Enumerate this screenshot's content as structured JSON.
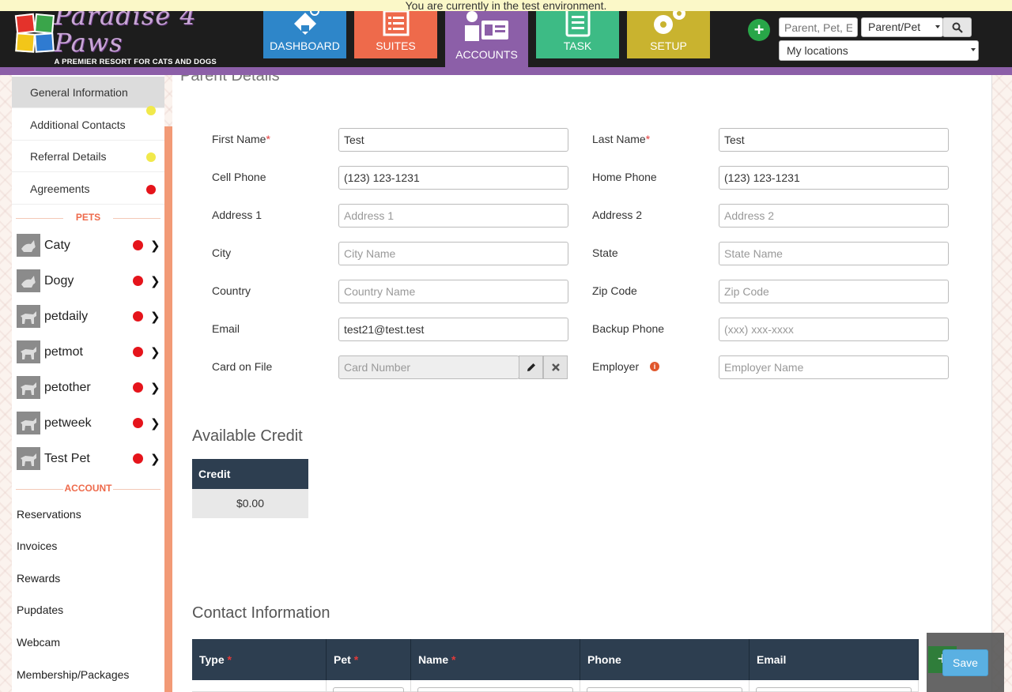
{
  "banner": {
    "text": "You are currently in the test environment."
  },
  "logo": {
    "title": "Paradise 4 Paws",
    "subtitle": "A PREMIER RESORT FOR CATS AND DOGS"
  },
  "nav": {
    "dashboard": "DASHBOARD",
    "suites": "SUITES",
    "accounts": "ACCOUNTS",
    "task": "TASK",
    "setup": "SETUP"
  },
  "search": {
    "placeholder": "Parent, Pet, E",
    "type": "Parent/Pet",
    "locations": "My locations"
  },
  "sidebar": {
    "items": [
      {
        "label": "General Information",
        "dot": "#f1e94b"
      },
      {
        "label": "Additional Contacts",
        "dot": ""
      },
      {
        "label": "Referral Details",
        "dot": "#f1e94b"
      },
      {
        "label": "Agreements",
        "dot": "#e5141b"
      }
    ],
    "pets_title": "PETS",
    "pets": [
      "Caty",
      "Dogy",
      "petdaily",
      "petmot",
      "petother",
      "petweek",
      "Test Pet"
    ],
    "account_title": "ACCOUNT",
    "account_links": [
      "Reservations",
      "Invoices",
      "Rewards",
      "Pupdates",
      "Webcam",
      "Membership/Packages"
    ]
  },
  "main": {
    "title": "Parent Details",
    "fields": {
      "first_name": {
        "label": "First Name",
        "value": "Test"
      },
      "last_name": {
        "label": "Last Name",
        "value": "Test"
      },
      "cell_phone": {
        "label": "Cell Phone",
        "value": "(123) 123-1231"
      },
      "home_phone": {
        "label": "Home Phone",
        "value": "(123) 123-1231"
      },
      "address1": {
        "label": "Address 1",
        "placeholder": "Address 1"
      },
      "address2": {
        "label": "Address 2",
        "placeholder": "Address 2"
      },
      "city": {
        "label": "City",
        "placeholder": "City Name"
      },
      "state": {
        "label": "State",
        "placeholder": "State Name"
      },
      "country": {
        "label": "Country",
        "placeholder": "Country Name"
      },
      "zip": {
        "label": "Zip Code",
        "placeholder": "Zip Code"
      },
      "email": {
        "label": "Email",
        "value": "test21@test.test"
      },
      "backup_phone": {
        "label": "Backup Phone",
        "placeholder": "(xxx) xxx-xxxx"
      },
      "card": {
        "label": "Card on File",
        "placeholder": "Card Number"
      },
      "employer": {
        "label": "Employer",
        "placeholder": "Employer Name"
      }
    },
    "required_mark": "*",
    "credit": {
      "title": "Available Credit",
      "header": "Credit",
      "value": "$0.00"
    },
    "contacts": {
      "title": "Contact Information",
      "columns": [
        "Type",
        "Pet",
        "Name",
        "Phone",
        "Email"
      ]
    }
  },
  "actions": {
    "save": "Save"
  }
}
